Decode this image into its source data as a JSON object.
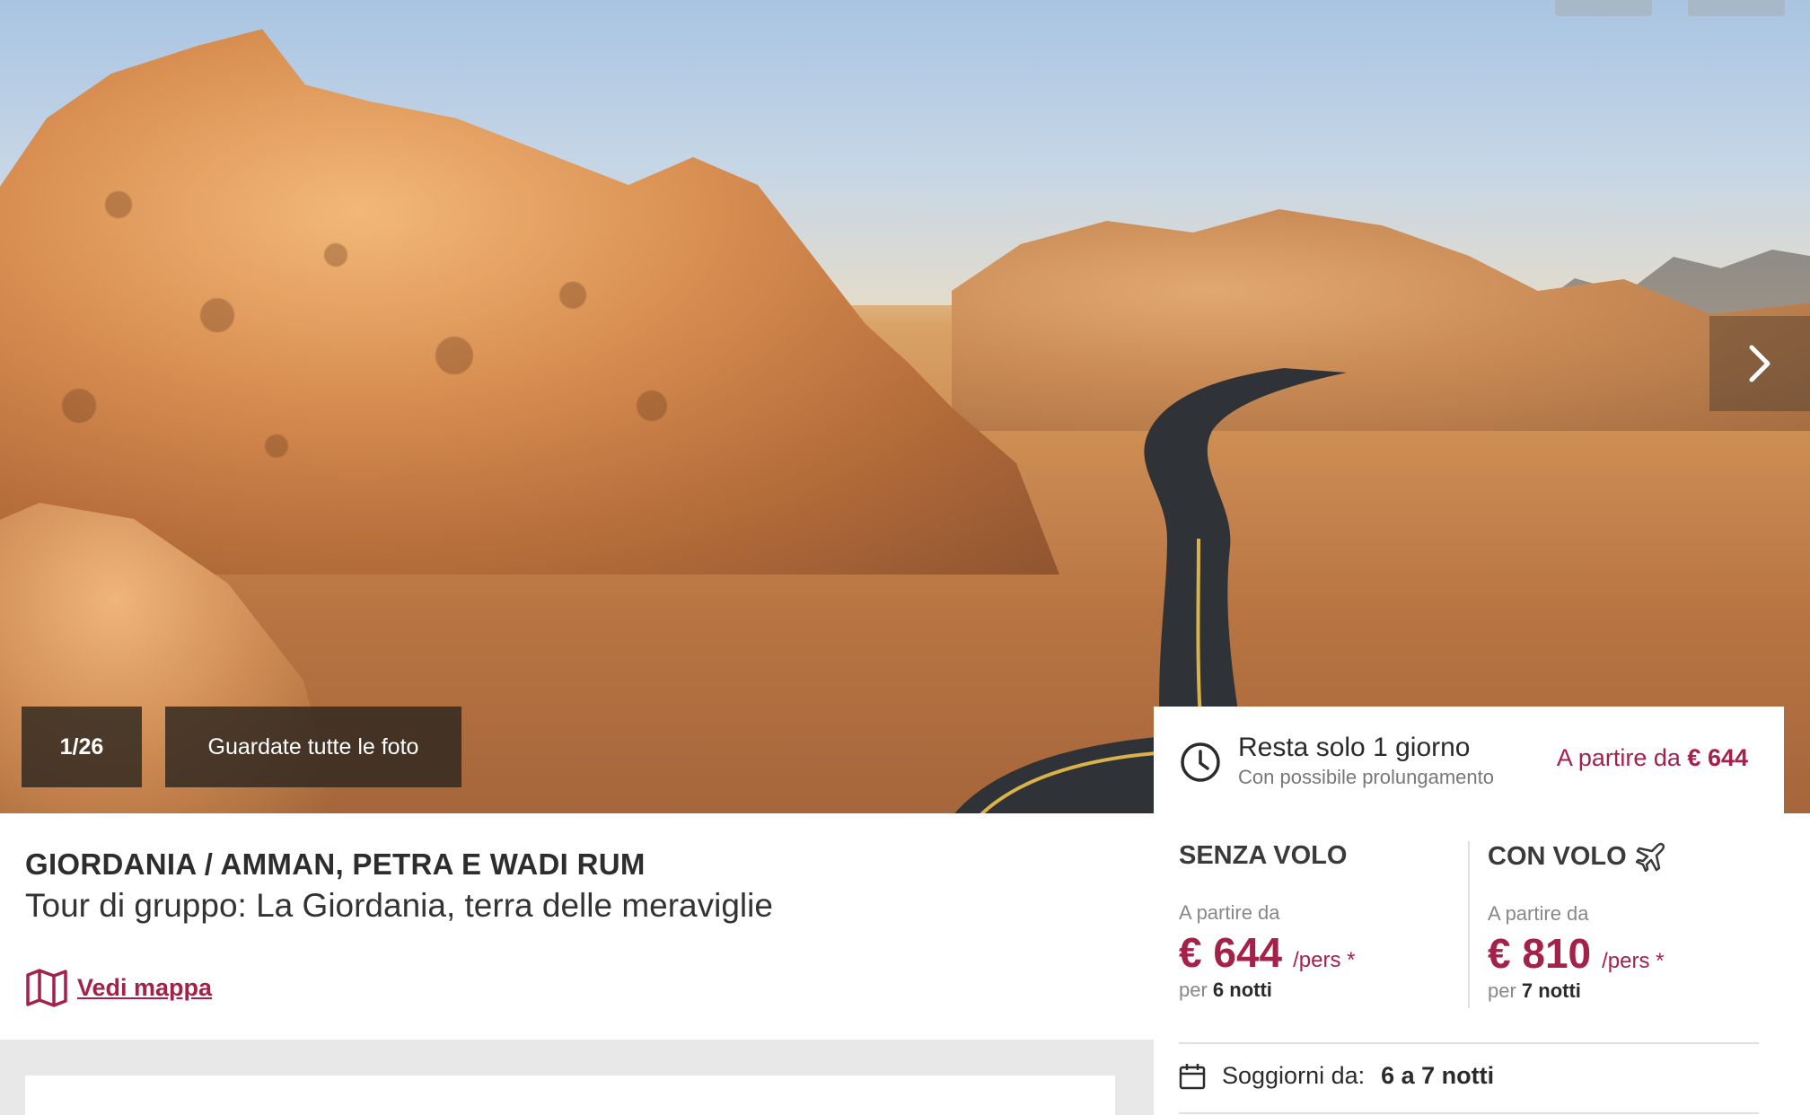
{
  "gallery": {
    "counter": "1/26",
    "all_photos_label": "Guardate tutte le foto",
    "next_icon": "chevron-right-icon"
  },
  "trip": {
    "title": "GIORDANIA / AMMAN, PETRA E WADI RUM",
    "subtitle": "Tour di gruppo: La Giordania, terra delle meraviglie",
    "map_link": "Vedi mappa"
  },
  "booking": {
    "deadline_title": "Resta solo 1 giorno",
    "deadline_sub": "Con possibile prolungamento",
    "from_label_top": "A partire da",
    "from_price_top": "€ 644",
    "without_flight": {
      "heading": "SENZA VOLO",
      "from_label": "A partire da",
      "price": "€ 644",
      "per_person": "/pers *",
      "per_label": "per",
      "nights": "6 notti"
    },
    "with_flight": {
      "heading": "CON VOLO",
      "from_label": "A partire da",
      "price": "€ 810",
      "per_person": "/pers *",
      "per_label": "per",
      "nights": "7 notti"
    },
    "stays_label": "Soggiorni da:",
    "stays_value": "6 a 7 notti"
  },
  "colors": {
    "accent": "#a4224a",
    "text": "#2b2b2b",
    "muted": "#888888"
  }
}
